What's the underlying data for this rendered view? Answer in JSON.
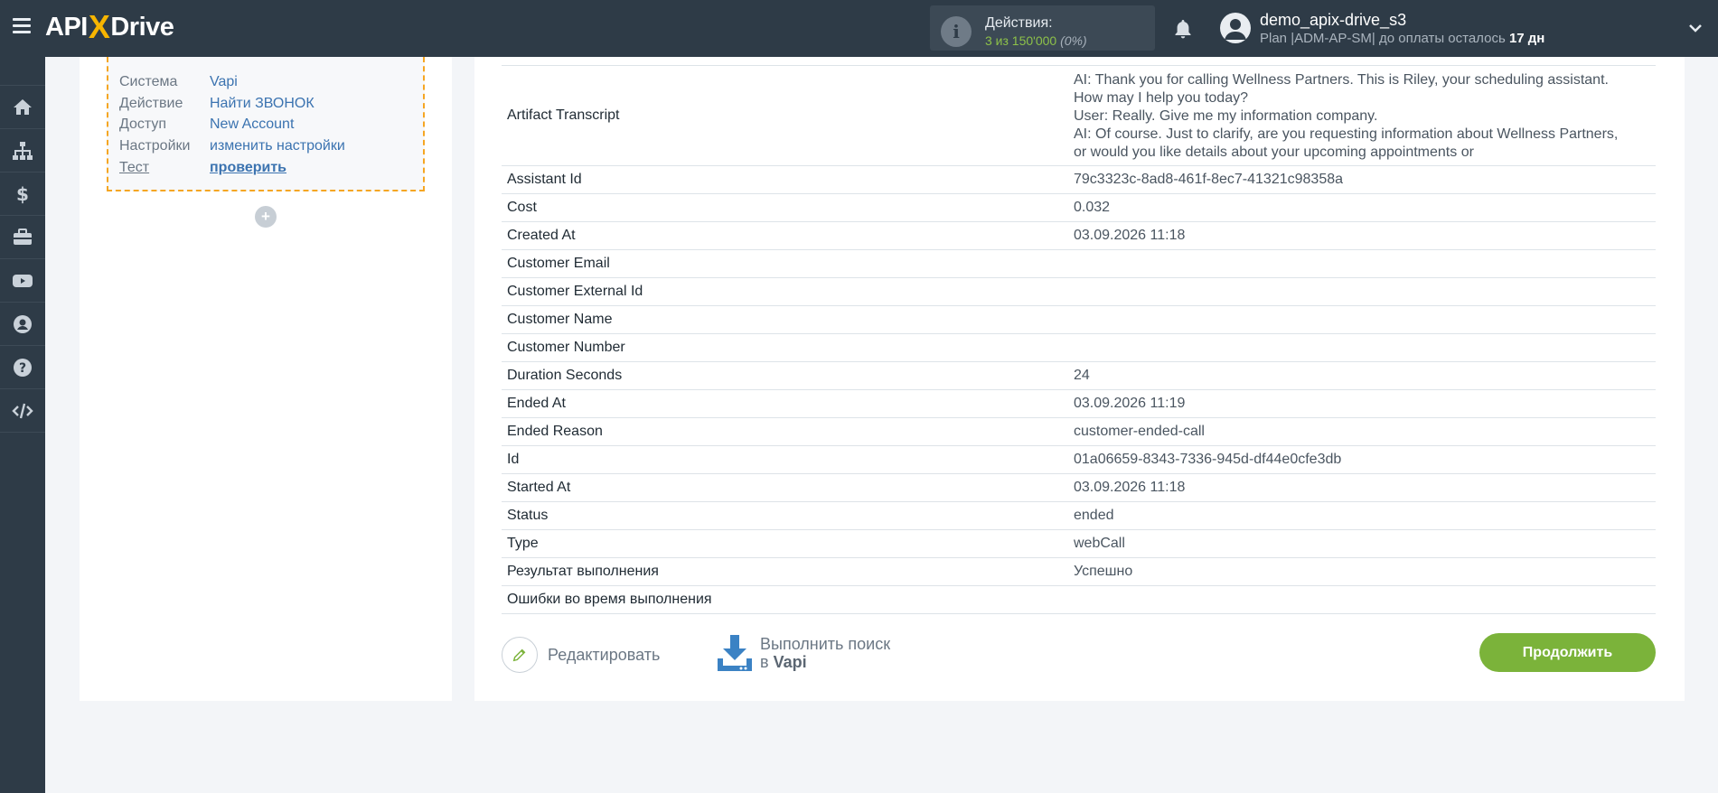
{
  "header": {
    "logo_left": "API",
    "logo_x": "X",
    "logo_right": "Drive",
    "actions_label": "Действия:",
    "actions_value": "3 из 150'000",
    "actions_percent": "(0%)",
    "username": "demo_apix-drive_s3",
    "plan_text": "Plan |ADM-AP-SM| до оплаты осталось",
    "days_left": "17 дн"
  },
  "sidebar": {
    "icons": [
      "home-icon",
      "sitemap-icon",
      "dollar-icon",
      "briefcase-icon",
      "youtube-icon",
      "user-circle-icon",
      "help-icon",
      "code-icon"
    ]
  },
  "summary": {
    "rows": [
      {
        "key": "Система",
        "value": "Vapi"
      },
      {
        "key": "Действие",
        "value": "Найти ЗВОНОК"
      },
      {
        "key": "Доступ",
        "value": "New Account"
      },
      {
        "key": "Настройки",
        "value": "изменить настройки"
      },
      {
        "key": "Тест",
        "value": "проверить"
      }
    ],
    "add_label": "+"
  },
  "table": {
    "transcript_key": "Artifact Transcript",
    "transcript_lines": [
      "AI: Thank you for calling Wellness Partners. This is Riley, your scheduling assistant.",
      "How may I help you today?",
      "User: Really. Give me my information company.",
      "AI: Of course. Just to clarify, are you requesting information about Wellness Partners,",
      "or would you like details about your upcoming appointments or"
    ],
    "rows": [
      {
        "key": "Assistant Id",
        "value": "79c3323c-8ad8-461f-8ec7-41321c98358a"
      },
      {
        "key": "Cost",
        "value": "0.032"
      },
      {
        "key": "Created At",
        "value": "03.09.2026 11:18"
      },
      {
        "key": "Customer Email",
        "value": ""
      },
      {
        "key": "Customer External Id",
        "value": ""
      },
      {
        "key": "Customer Name",
        "value": ""
      },
      {
        "key": "Customer Number",
        "value": ""
      },
      {
        "key": "Duration Seconds",
        "value": "24"
      },
      {
        "key": "Ended At",
        "value": "03.09.2026 11:19"
      },
      {
        "key": "Ended Reason",
        "value": "customer-ended-call"
      },
      {
        "key": "Id",
        "value": "01a06659-8343-7336-945d-df44e0cfe3db"
      },
      {
        "key": "Started At",
        "value": "03.09.2026 11:18"
      },
      {
        "key": "Status",
        "value": "ended"
      },
      {
        "key": "Type",
        "value": "webCall"
      },
      {
        "key": "Результат выполнения",
        "value": "Успешно"
      },
      {
        "key": "Ошибки во время выполнения",
        "value": ""
      }
    ]
  },
  "buttons": {
    "edit": "Редактировать",
    "search_line1": "Выполнить поиск",
    "search_prefix": "в",
    "search_target": "Vapi",
    "continue": "Продолжить"
  },
  "colors": {
    "accent_green": "#7bb33a",
    "link_blue": "#3b73b0",
    "dark_nav": "#2e3b47",
    "highlight_orange": "#f5a623"
  }
}
